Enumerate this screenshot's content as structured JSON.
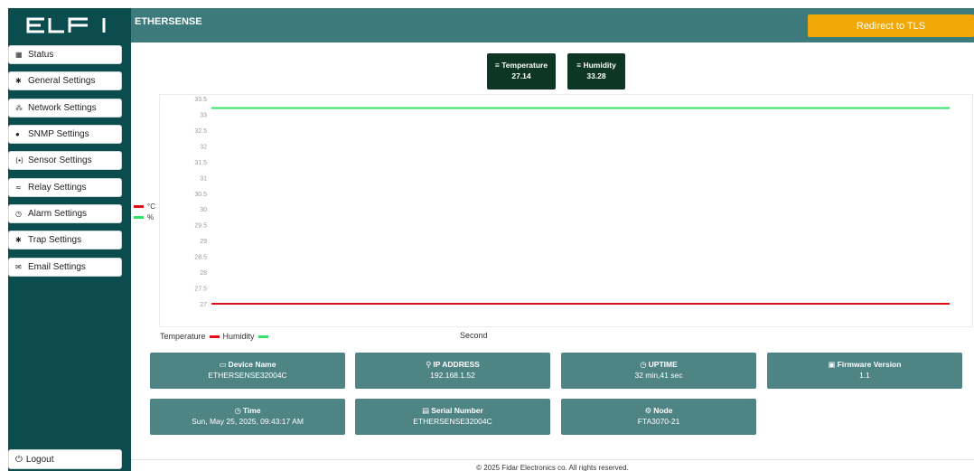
{
  "brand": {
    "logo_text": "ELFI"
  },
  "header": {
    "title": "ETHERSENSE",
    "tls_button": "Redirect to TLS"
  },
  "sidebar": {
    "items": [
      {
        "label": "Status",
        "icon": "dashboard-icon"
      },
      {
        "label": "General Settings",
        "icon": "gear-icon"
      },
      {
        "label": "Network Settings",
        "icon": "network-icon"
      },
      {
        "label": "SNMP Settings",
        "icon": "globe-icon"
      },
      {
        "label": "Sensor Settings",
        "icon": "sensor-icon"
      },
      {
        "label": "Relay Settings",
        "icon": "relay-icon"
      },
      {
        "label": "Alarm Settings",
        "icon": "alarm-icon"
      },
      {
        "label": "Trap Settings",
        "icon": "gear-icon"
      },
      {
        "label": "Email Settings",
        "icon": "envelope-icon"
      }
    ],
    "logout": "Logout"
  },
  "sensors": {
    "temperature": {
      "label": "Temperature",
      "value": "27.14"
    },
    "humidity": {
      "label": "Humidity",
      "value": "33.28"
    }
  },
  "chart_data": {
    "type": "line",
    "ylim": [
      26.8,
      33.5
    ],
    "yticks": [
      "33.5",
      "33",
      "32.5",
      "32",
      "31.5",
      "31",
      "30.5",
      "30",
      "29.5",
      "29",
      "28.5",
      "28",
      "27.5",
      "27"
    ],
    "xlabel": "Second",
    "x": [
      0,
      1,
      2,
      3,
      4,
      5,
      6,
      7,
      8,
      9,
      10,
      11,
      12,
      13,
      14,
      15,
      16,
      17,
      18,
      19,
      20
    ],
    "series": [
      {
        "name": "Temperature",
        "unit": "°C",
        "color": "#e0101a",
        "values": [
          27.0,
          27.0,
          27.0,
          27.0,
          27.0,
          27.0,
          27.0,
          27.0,
          27.0,
          27.0,
          27.0,
          27.0,
          27.0,
          27.0,
          27.0,
          27.0,
          27.0,
          27.0,
          27.0,
          27.0,
          27.0
        ]
      },
      {
        "name": "Humidity",
        "unit": "%",
        "color": "#33e06a",
        "values": [
          33.2,
          33.2,
          33.2,
          33.2,
          33.2,
          33.2,
          33.2,
          33.2,
          33.2,
          33.2,
          33.2,
          33.2,
          33.2,
          33.2,
          33.2,
          33.2,
          33.2,
          33.2,
          33.2,
          33.2,
          33.2
        ]
      }
    ],
    "legend_side": [
      "°C",
      "%"
    ],
    "legend_bottom": [
      "Temperature",
      "Humidity"
    ]
  },
  "info": {
    "device_name": {
      "label": "Device Name",
      "value": "ETHERSENSE32004C"
    },
    "ip_address": {
      "label": "IP ADDRESS",
      "value": "192.168.1.52"
    },
    "uptime": {
      "label": "UPTIME",
      "value": "32 min,41 sec"
    },
    "firmware": {
      "label": "Firmware Version",
      "value": "1.1"
    },
    "time": {
      "label": "Time",
      "value": "Sun, May 25, 2025, 09:43:17 AM"
    },
    "serial": {
      "label": "Serial Number",
      "value": "ETHERSENSE32004C"
    },
    "node": {
      "label": "Node",
      "value": "FTA3070-21"
    }
  },
  "footer": {
    "text": "© 2025 Fidar Electronics co. All rights reserved."
  }
}
